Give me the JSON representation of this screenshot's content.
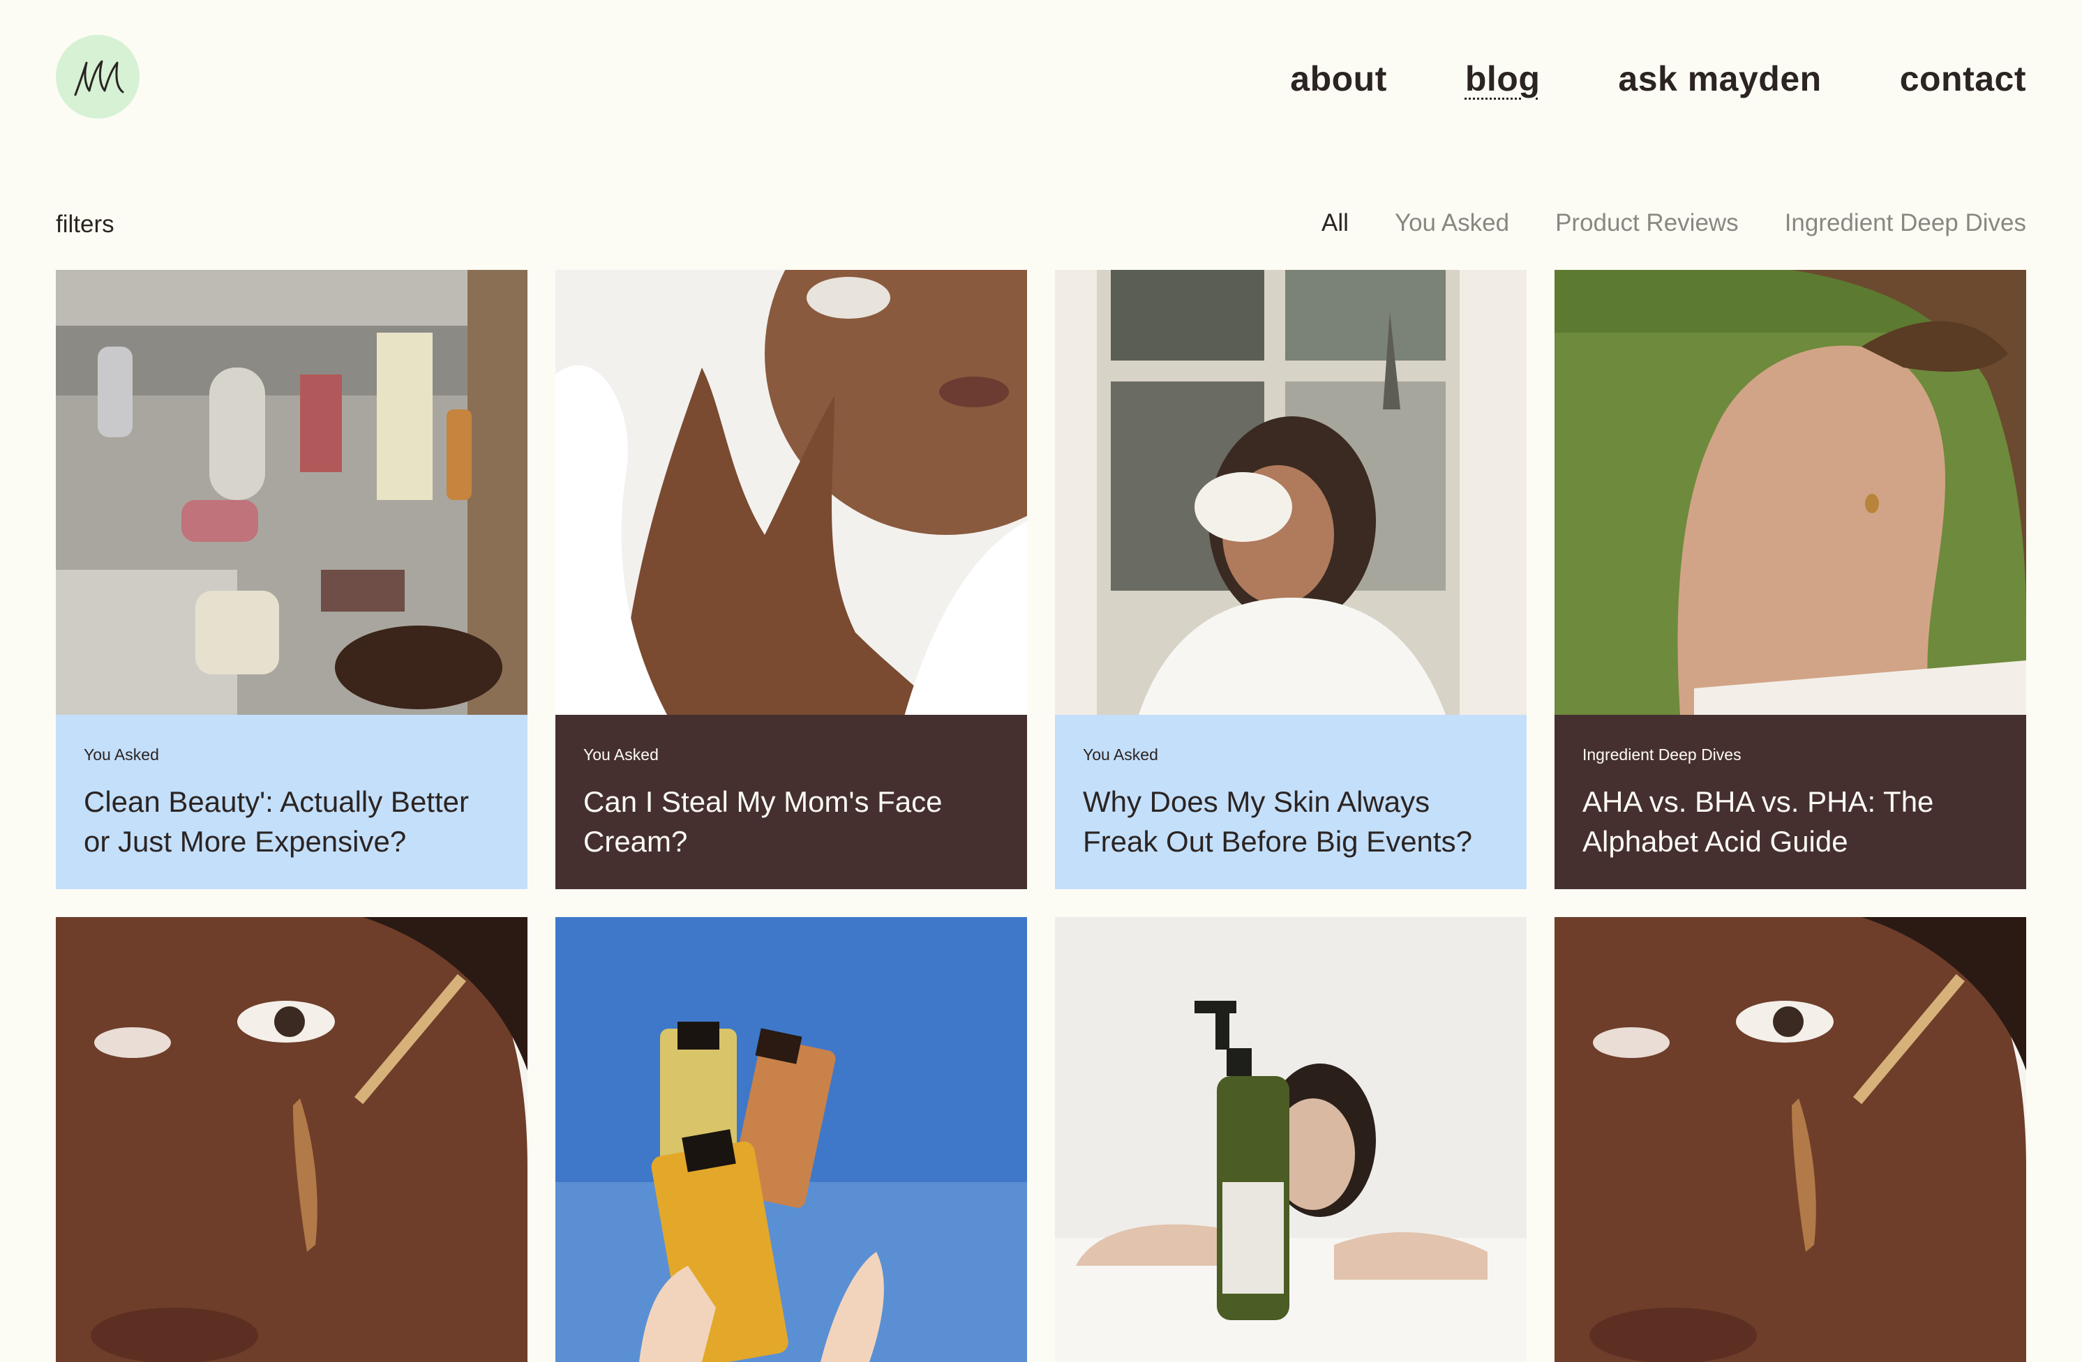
{
  "header": {
    "logo_text": "m",
    "nav": [
      {
        "label": "about",
        "active": false
      },
      {
        "label": "blog",
        "active": true
      },
      {
        "label": "ask mayden",
        "active": false
      },
      {
        "label": "contact",
        "active": false
      }
    ]
  },
  "filters": {
    "label": "filters",
    "tabs": [
      "All",
      "You Asked",
      "Product Reviews",
      "Ingredient Deep Dives"
    ],
    "selected": "All"
  },
  "posts": [
    {
      "tag": "You Asked",
      "title": "Clean Beauty': Actually Better or Just More Expensive?",
      "image": "skincare-products-on-vanity",
      "theme": "light"
    },
    {
      "tag": "You Asked",
      "title": "Can I Steal My Mom's Face Cream?",
      "image": "woman-applying-face-cream",
      "theme": "dark"
    },
    {
      "tag": "You Asked",
      "title": "Why Does My Skin Always Freak Out Before Big Events?",
      "image": "woman-drinking-coffee-paris-window",
      "theme": "light"
    },
    {
      "tag": "Ingredient Deep Dives",
      "title": "AHA vs. BHA vs. PHA: The Alphabet Acid Guide",
      "image": "woman-in-sunlight",
      "theme": "dark"
    },
    {
      "tag": "",
      "title": "",
      "image": "serum-dropper-on-face"
    },
    {
      "tag": "",
      "title": "",
      "image": "hands-holding-perfume-bottles"
    },
    {
      "tag": "",
      "title": "",
      "image": "custom-cleanser-bottle"
    },
    {
      "tag": "",
      "title": "",
      "image": "serum-dropper-on-face"
    }
  ],
  "colors": {
    "background": "#fdfcf4",
    "logo_circle": "#d6f1d4",
    "caption_light": "#c4dffa",
    "caption_dark": "#45302f",
    "text": "#2b2422",
    "muted": "#8a8680"
  }
}
